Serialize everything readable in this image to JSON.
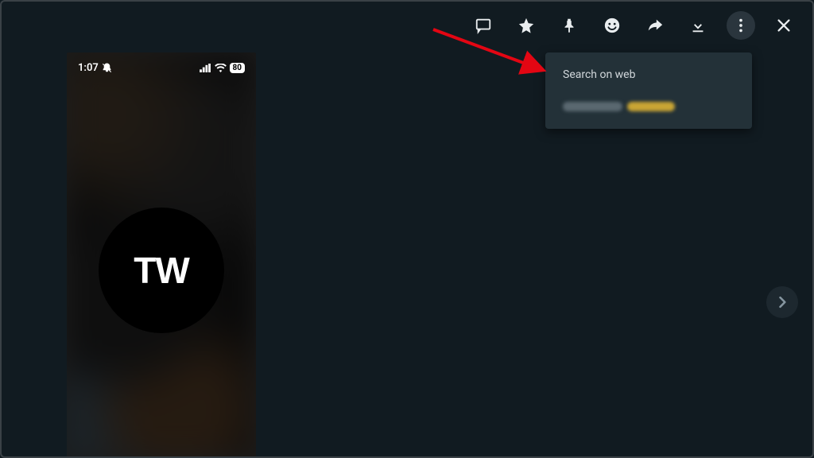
{
  "toolbar": {
    "icons": {
      "chat": "chat-icon",
      "star": "star-icon",
      "pin": "pin-icon",
      "emoji": "emoji-icon",
      "forward": "forward-icon",
      "download": "download-icon",
      "more": "more-vertical-icon",
      "close": "close-icon"
    }
  },
  "dropdown": {
    "items": [
      {
        "label": "Search on web"
      }
    ]
  },
  "phone": {
    "statusbar": {
      "time": "1:07",
      "battery_level": "80"
    },
    "logo_text": "TW"
  },
  "annotation": {
    "arrow_color": "#e30613"
  },
  "nav": {
    "next": "chevron-right-icon"
  }
}
